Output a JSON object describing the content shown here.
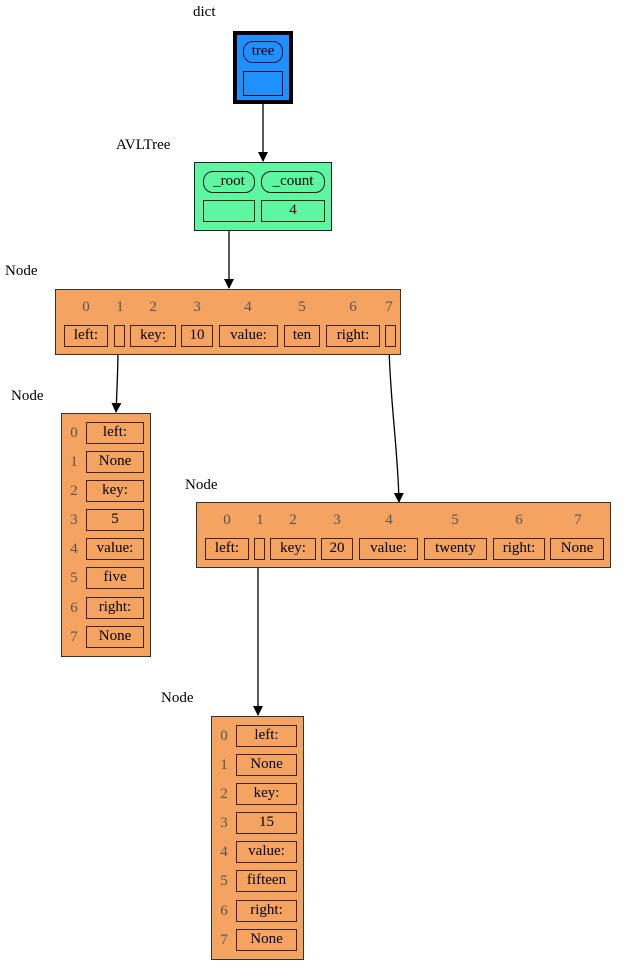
{
  "dict": {
    "label": "dict",
    "key": "tree",
    "value": ""
  },
  "avltree": {
    "label": "AVLTree",
    "fields": [
      "_root",
      "_count"
    ],
    "values": [
      "",
      "4"
    ]
  },
  "node10": {
    "label": "Node",
    "indices": [
      "0",
      "1",
      "2",
      "3",
      "4",
      "5",
      "6",
      "7"
    ],
    "cells": [
      "left:",
      "",
      "key:",
      "10",
      "value:",
      "ten",
      "right:",
      ""
    ]
  },
  "node5": {
    "label": "Node",
    "indices": [
      "0",
      "1",
      "2",
      "3",
      "4",
      "5",
      "6",
      "7"
    ],
    "cells": [
      "left:",
      "None",
      "key:",
      "5",
      "value:",
      "five",
      "right:",
      "None"
    ]
  },
  "node20": {
    "label": "Node",
    "indices": [
      "0",
      "1",
      "2",
      "3",
      "4",
      "5",
      "6",
      "7"
    ],
    "cells": [
      "left:",
      "",
      "key:",
      "20",
      "value:",
      "twenty",
      "right:",
      "None"
    ]
  },
  "node15": {
    "label": "Node",
    "indices": [
      "0",
      "1",
      "2",
      "3",
      "4",
      "5",
      "6",
      "7"
    ],
    "cells": [
      "left:",
      "None",
      "key:",
      "15",
      "value:",
      "fifteen",
      "right:",
      "None"
    ]
  },
  "colors": {
    "dict": "#1e90ff",
    "avltree": "#5cf7a0",
    "node": "#f4a460"
  }
}
